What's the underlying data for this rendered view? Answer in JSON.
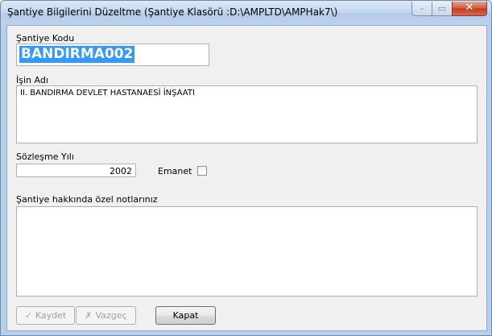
{
  "window": {
    "title": "Şantiye Bilgilerini Düzeltme (Şantiye Klasörü :D:\\AMPLTD\\AMPHak7\\)",
    "minimize_glyph": "–",
    "maximize_glyph": "▭",
    "close_glyph": "✕"
  },
  "form": {
    "code_label": "Şantiye Kodu",
    "code_value": "BANDIRMA002",
    "job_label": "İşin Adı",
    "job_value": "II. BANDIRMA DEVLET HASTANAESİ İNŞAATI",
    "year_label": "Sözleşme Yılı",
    "year_value": "2002",
    "emanet_label": "Emanet",
    "emanet_checked": false,
    "notes_label": "Şantiye hakkında özel notlarınız",
    "notes_value": ""
  },
  "buttons": {
    "save_label": "Kaydet",
    "save_icon": "check-icon",
    "cancel_label": "Vazgeç",
    "cancel_icon": "cross-icon",
    "close_label": "Kapat"
  }
}
